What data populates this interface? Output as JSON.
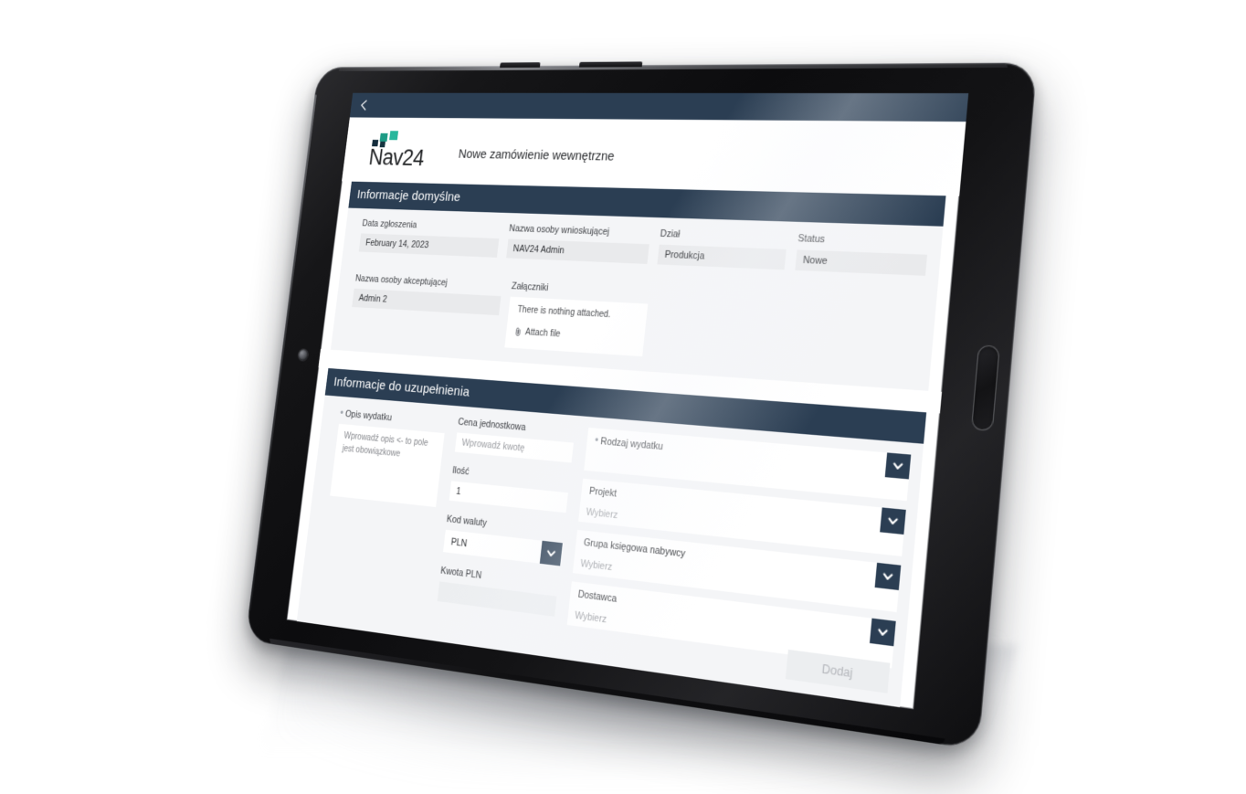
{
  "app": {
    "brand_name": "Nav24",
    "page_title": "Nowe zamówienie wewnętrzne",
    "back_icon": "chevron-left-icon",
    "accent_navy": "#2b3e53",
    "logo_teal": "#27b79c",
    "logo_dark": "#132c3c"
  },
  "section_default": {
    "heading": "Informacje domyślne",
    "fields": {
      "date_label": "Data zgłoszenia",
      "date_value": "February 14, 2023",
      "requester_label": "Nazwa osoby wnioskującej",
      "requester_value": "NAV24 Admin",
      "department_label": "Dział",
      "department_value": "Produkcja",
      "status_label": "Status",
      "status_value": "Nowe",
      "approver_label": "Nazwa osoby akceptującej",
      "approver_value": "Admin 2",
      "attachments_label": "Załączniki",
      "attachments_empty": "There is nothing attached.",
      "attach_link": "Attach file",
      "attach_icon": "paperclip-icon"
    }
  },
  "section_fill": {
    "heading": "Informacje do uzupełnienia",
    "description": {
      "label": "Opis wydatku",
      "required": true,
      "placeholder": "Wprowadź opis <- to pole jest obowiązkowe",
      "value": ""
    },
    "unit_price": {
      "label": "Cena jednostkowa",
      "placeholder": "Wprowadź kwotę",
      "value": ""
    },
    "quantity": {
      "label": "Ilość",
      "value": "1"
    },
    "currency_code": {
      "label": "Kod waluty",
      "value": "PLN",
      "chevron_icon": "chevron-down-icon"
    },
    "amount_pln": {
      "label": "Kwota PLN",
      "value": ""
    },
    "expense_type": {
      "label": "Rodzaj wydatku",
      "required": true,
      "value": "",
      "chevron_icon": "chevron-down-icon"
    },
    "project": {
      "label": "Projekt",
      "placeholder": "Wybierz",
      "value": "",
      "chevron_icon": "chevron-down-icon"
    },
    "buyer_posting_group": {
      "label": "Grupa księgowa nabywcy",
      "placeholder": "Wybierz",
      "value": "",
      "chevron_icon": "chevron-down-icon"
    },
    "supplier": {
      "label": "Dostawca",
      "placeholder": "Wybierz",
      "value": "",
      "chevron_icon": "chevron-down-icon"
    },
    "add_button": "Dodaj"
  }
}
